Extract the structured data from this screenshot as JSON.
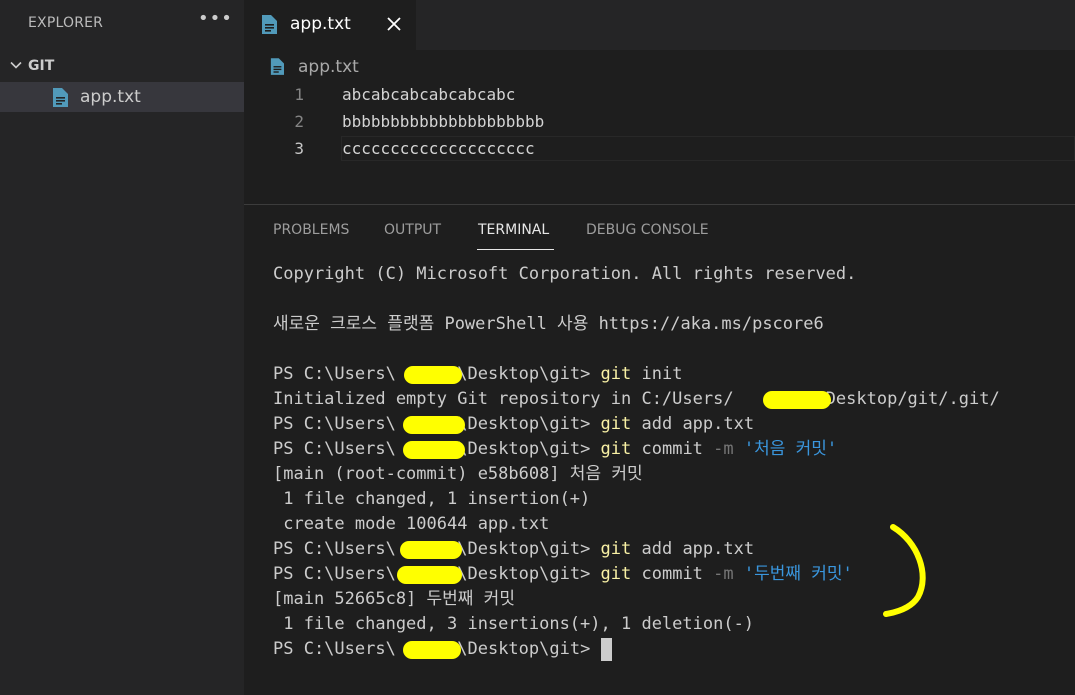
{
  "explorer": {
    "header": "EXPLORER",
    "more_icon": "ellipsis-icon",
    "folder": {
      "label": "GIT",
      "icon": "chevron-down-icon"
    },
    "files": [
      {
        "label": "app.txt",
        "icon": "file-icon"
      }
    ]
  },
  "tabs": [
    {
      "label": "app.txt",
      "icon": "file-icon",
      "close_icon": "close-icon"
    }
  ],
  "breadcrumb": {
    "label": "app.txt",
    "icon": "file-icon"
  },
  "editor": {
    "lines": [
      {
        "number": "1",
        "text": "abcabcabcabcabcabc"
      },
      {
        "number": "2",
        "text": "bbbbbbbbbbbbbbbbbbbbb"
      },
      {
        "number": "3",
        "text": "cccccccccccccccccccc"
      }
    ]
  },
  "panel": {
    "tabs": [
      {
        "label": "PROBLEMS"
      },
      {
        "label": "OUTPUT"
      },
      {
        "label": "TERMINAL"
      },
      {
        "label": "DEBUG CONSOLE"
      }
    ],
    "active_tab": "TERMINAL"
  },
  "terminal": {
    "lines": [
      "Copyright (C) Microsoft Corporation. All rights reserved.",
      "",
      "새로운 크로스 플랫폼 PowerShell 사용 https://aka.ms/pscore6",
      "",
      {
        "prompt": "PS C:\\Users\\",
        "prompt_end": "\\Desktop\\git> ",
        "cmd": "git",
        "args": " init"
      },
      "Initialized empty Git repository in C:/Users/        /Desktop/git/.git/",
      {
        "prompt": "PS C:\\Users\\",
        "prompt_end": "\\Desktop\\git> ",
        "cmd": "git",
        "args": " add app.txt"
      },
      {
        "prompt": "PS C:\\Users\\",
        "prompt_end": "\\Desktop\\git> ",
        "cmd": "git",
        "args": " commit ",
        "flag": "-m",
        "str": " '처음 커밋'"
      },
      "[main (root-commit) e58b608] 처음 커밋",
      " 1 file changed, 1 insertion(+)",
      " create mode 100644 app.txt",
      {
        "prompt": "PS C:\\Users\\",
        "prompt_end": "\\Desktop\\git> ",
        "cmd": "git",
        "args": " add app.txt"
      },
      {
        "prompt": "PS C:\\Users\\",
        "prompt_end": "\\Desktop\\git> ",
        "cmd": "git",
        "args": " commit ",
        "flag": "-m",
        "str": " '두번째 커밋'"
      },
      "[main 52665c8] 두번째 커밋",
      " 1 file changed, 3 insertions(+), 1 deletion(-)",
      {
        "prompt": "PS C:\\Users\\",
        "prompt_end": "\\Desktop\\git> ",
        "cursor": true
      }
    ]
  },
  "colors": {
    "sidebar_bg": "#252526",
    "editor_bg": "#1e1e1e",
    "file_icon": "#519aba",
    "command": "#f9f1a5",
    "string": "#3a96dd",
    "redaction": "#ffff00"
  }
}
